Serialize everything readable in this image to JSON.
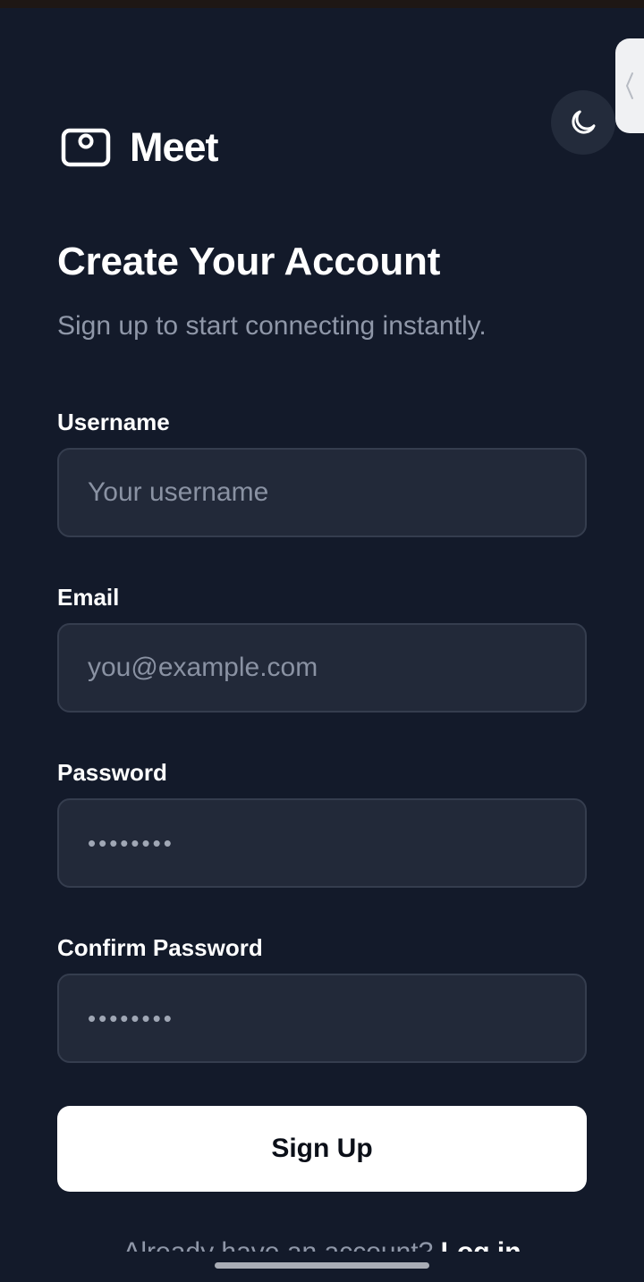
{
  "brand": {
    "name": "Meet"
  },
  "header": {
    "title": "Create Your Account",
    "subtitle": "Sign up to start connecting instantly."
  },
  "form": {
    "username": {
      "label": "Username",
      "placeholder": "Your username",
      "value": ""
    },
    "email": {
      "label": "Email",
      "placeholder": "you@example.com",
      "value": ""
    },
    "password": {
      "label": "Password",
      "placeholder": "••••••••",
      "value": ""
    },
    "confirm_password": {
      "label": "Confirm Password",
      "placeholder": "••••••••",
      "value": ""
    },
    "submit_label": "Sign Up"
  },
  "footer": {
    "prompt": "Already have an account?",
    "login_label": "Log in"
  },
  "icons": {
    "theme_toggle": "moon-icon",
    "logo": "camera-icon",
    "side_handle": "chevron-left-icon"
  },
  "colors": {
    "background": "#131a2a",
    "input_background": "#222939",
    "input_border": "#353d4e",
    "primary_button": "#ffffff",
    "muted_text": "#8f97a8"
  }
}
